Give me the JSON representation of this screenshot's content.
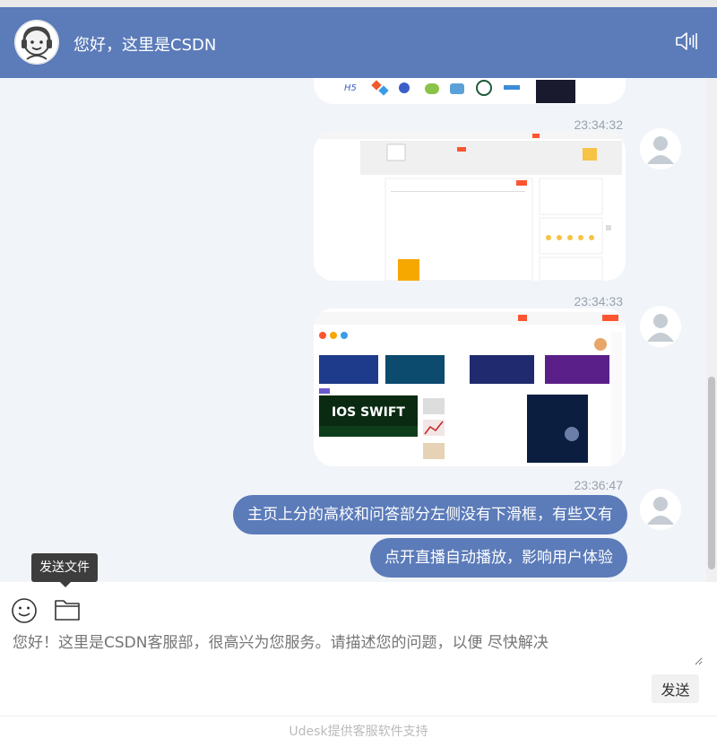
{
  "header": {
    "title": "您好，这里是CSDN"
  },
  "messages": [
    {
      "timestamp": "23:34:32",
      "type": "image"
    },
    {
      "timestamp": "23:34:33",
      "type": "image"
    },
    {
      "timestamp": "23:36:47",
      "type": "text",
      "lines": [
        "主页上分的高校和问答部分左侧没有下滑框，有些又有",
        "点开直播自动播放，影响用户体验"
      ]
    }
  ],
  "image3": {
    "banner_text": "IOS SWIFT"
  },
  "tooltip": {
    "text": "发送文件"
  },
  "composer": {
    "placeholder": "您好！这里是CSDN客服部，很高兴为您服务。请描述您的问题，以便 尽快解决",
    "send_label": "发送"
  },
  "footer": {
    "text": "Udesk提供客服软件支持"
  },
  "colors": {
    "brand": "#5b7bb9",
    "chat_bg": "#f1f4f8",
    "csdn_red": "#fc5531"
  }
}
